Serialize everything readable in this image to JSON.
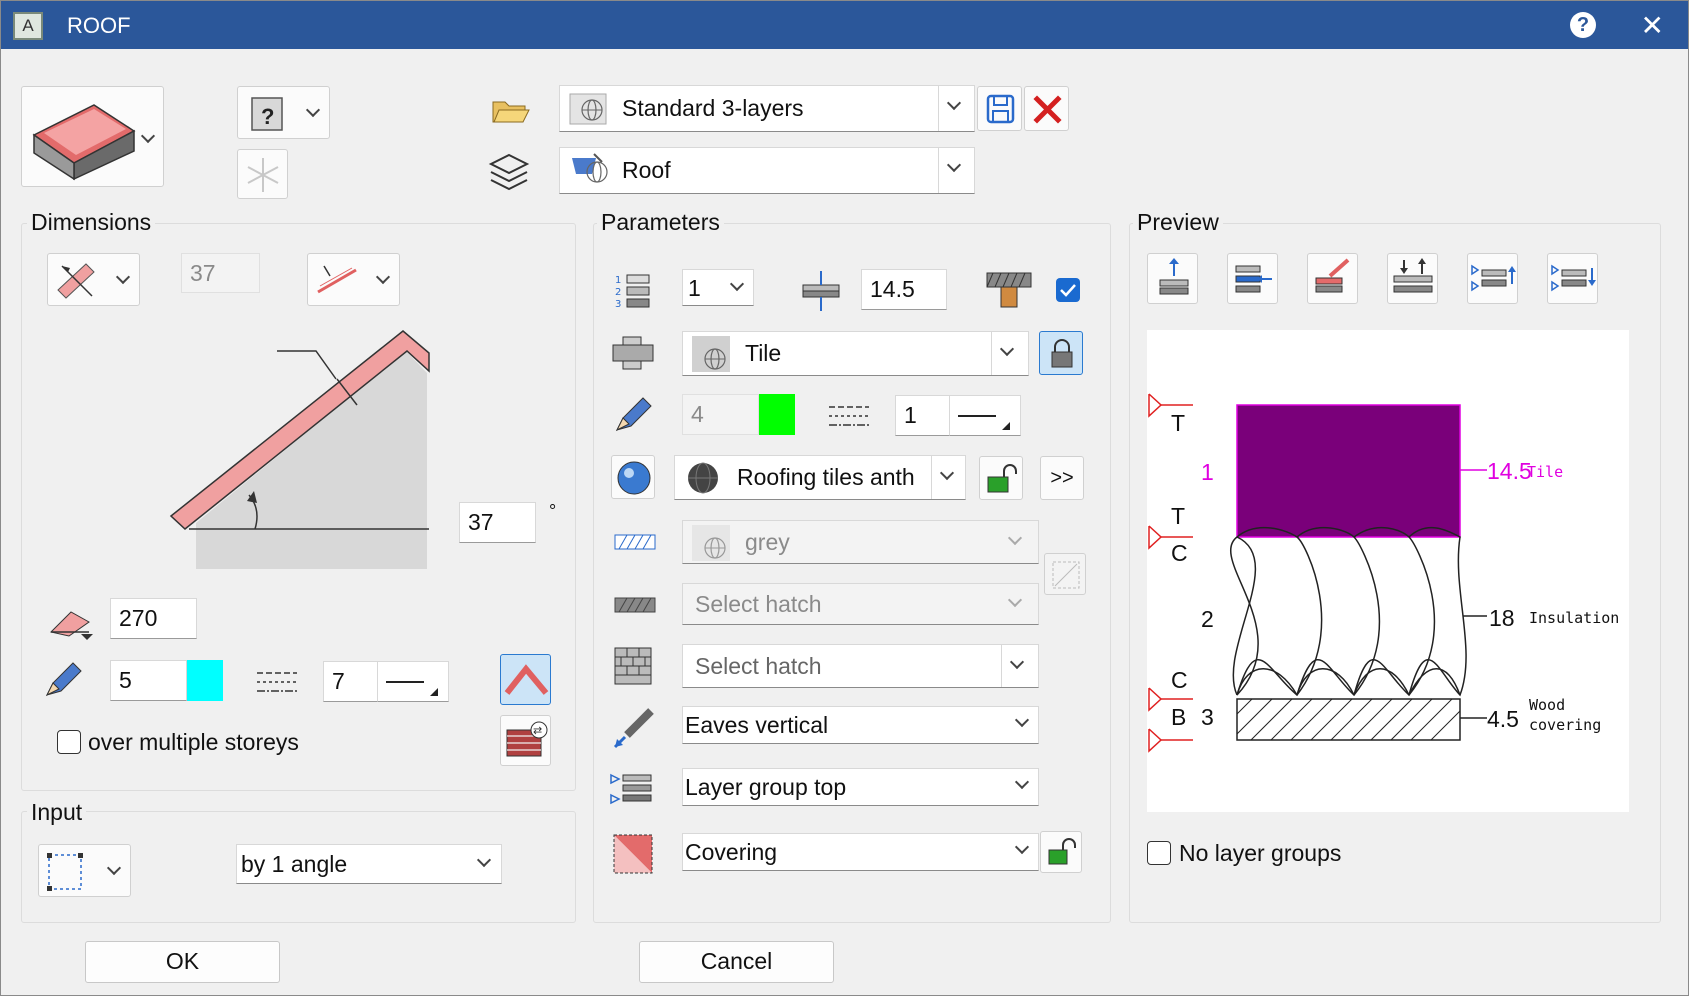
{
  "window": {
    "title": "ROOF"
  },
  "favorites": {
    "name": "Standard 3-layers"
  },
  "layer": {
    "name": "Roof"
  },
  "dimensions": {
    "label": "Dimensions",
    "thickness_value": "37",
    "angle_value": "37",
    "degree_symbol": "°",
    "direction_value": "270",
    "pen_value": "5",
    "pen_color": "#00ffff",
    "linetype_value": "7",
    "over_multiple_storeys_label": "over multiple storeys"
  },
  "input": {
    "label": "Input",
    "mode": "by 1 angle"
  },
  "parameters": {
    "label": "Parameters",
    "layer_number": "1",
    "layer_thickness": "14.5",
    "material": "Tile",
    "pen_value": "4",
    "pen_color": "#00ff00",
    "linetype_value": "1",
    "surface": "Roofing tiles anth",
    "more_label": ">>",
    "fill": "grey",
    "hatch_1": "Select hatch",
    "hatch_2": "Select hatch",
    "eaves": "Eaves vertical",
    "layer_group": "Layer group top",
    "role": "Covering"
  },
  "preview": {
    "label": "Preview",
    "no_layer_groups_label": "No layer groups",
    "layers": [
      {
        "index": "1",
        "thickness": "14.5",
        "name": "Tile",
        "color": "#7a007a"
      },
      {
        "index": "2",
        "thickness": "18",
        "name": "Insulation"
      },
      {
        "index": "3",
        "thickness": "4.5",
        "name_line1": "Wood",
        "name_line2": "covering"
      }
    ],
    "markers": {
      "t1": "T",
      "t2": "T",
      "c1": "C",
      "c2": "C",
      "b": "B"
    }
  },
  "buttons": {
    "ok": "OK",
    "cancel": "Cancel"
  },
  "colors": {
    "accent": "#2b579a",
    "roof": "#f0a0a0",
    "tile_label": "#e000e0"
  }
}
